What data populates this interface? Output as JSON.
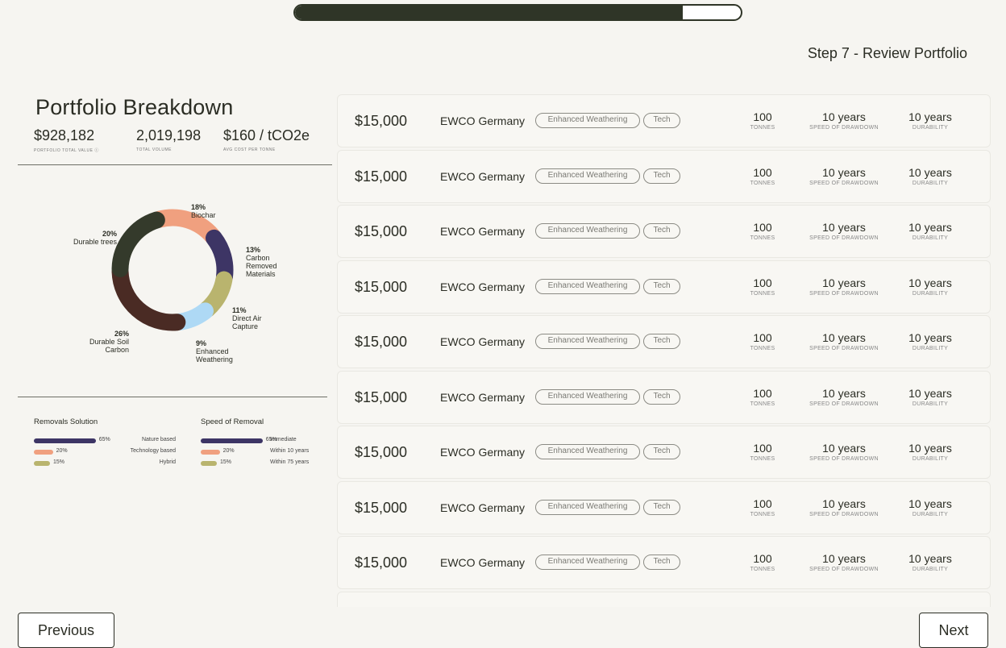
{
  "progress": {
    "value": 0.87
  },
  "step_title": "Step 7 - Review Portfolio",
  "breakdown": {
    "title": "Portfolio Breakdown",
    "stats": [
      {
        "value": "$928,182",
        "label": "PORTFOLIO TOTAL VALUE ⓘ"
      },
      {
        "value": "2,019,198",
        "label": "TOTAL VOLUME"
      },
      {
        "value": "$160 / tCO2e",
        "label": "AVG COST PER TONNE"
      }
    ]
  },
  "donut": {
    "segments": [
      {
        "name": "Biochar",
        "pct_label": "18%",
        "value": 18,
        "color": "#f0a07f"
      },
      {
        "name": "Carbon Removed Materials",
        "pct_label": "13%",
        "value": 13,
        "color": "#3d3565"
      },
      {
        "name": "Direct Air Capture",
        "pct_label": "11%",
        "value": 11,
        "color": "#b9b46e"
      },
      {
        "name": "Enhanced Weathering",
        "pct_label": "9%",
        "value": 9,
        "color": "#aed9f5"
      },
      {
        "name": "Durable Soil Carbon",
        "pct_label": "26%",
        "value": 26,
        "color": "#4a2b24"
      },
      {
        "name": "Durable trees",
        "pct_label": "20%",
        "value": 20,
        "color": "#343a2b"
      }
    ],
    "labels": {
      "biochar": {
        "pct": "18%",
        "text": "Biochar"
      },
      "crm": {
        "pct": "13%",
        "line1": "Carbon",
        "line2": "Removed",
        "line3": "Materials"
      },
      "dac": {
        "pct": "11%",
        "line1": "Direct Air",
        "line2": "Capture"
      },
      "ew": {
        "pct": "9%",
        "line1": "Enhanced",
        "line2": "Weathering"
      },
      "dsc": {
        "pct": "26%",
        "line1": "Durable Soil",
        "line2": "Carbon"
      },
      "trees": {
        "pct": "20%",
        "text": "Durable trees"
      }
    }
  },
  "removals_solution": {
    "title": "Removals Solution",
    "items": [
      {
        "pct": "65%",
        "value": 65,
        "name": "Nature based",
        "color": "#3d3565"
      },
      {
        "pct": "20%",
        "value": 20,
        "name": "Technology based",
        "color": "#f0a07f"
      },
      {
        "pct": "15%",
        "value": 15,
        "name": "Hybrid",
        "color": "#b9b46e"
      }
    ]
  },
  "speed_of_removal": {
    "title": "Speed of Removal",
    "items": [
      {
        "pct": "65%",
        "value": 65,
        "name": "Immediate",
        "color": "#3d3565"
      },
      {
        "pct": "20%",
        "value": 20,
        "name": "Within 10 years",
        "color": "#f0a07f"
      },
      {
        "pct": "15%",
        "value": 15,
        "name": "Within 75 years",
        "color": "#b9b46e"
      }
    ]
  },
  "projects": [
    {
      "price": "$15,000",
      "name": "EWCO Germany",
      "tag1": "Enhanced Weathering",
      "tag2": "Tech",
      "tonnes": "100",
      "tonnes_label": "TONNES",
      "speed": "10 years",
      "speed_label": "SPEED OF DRAWDOWN",
      "durability": "10 years",
      "durability_label": "DURABILITY"
    },
    {
      "price": "$15,000",
      "name": "EWCO Germany",
      "tag1": "Enhanced Weathering",
      "tag2": "Tech",
      "tonnes": "100",
      "tonnes_label": "TONNES",
      "speed": "10 years",
      "speed_label": "SPEED OF DRAWDOWN",
      "durability": "10 years",
      "durability_label": "DURABILITY"
    },
    {
      "price": "$15,000",
      "name": "EWCO Germany",
      "tag1": "Enhanced Weathering",
      "tag2": "Tech",
      "tonnes": "100",
      "tonnes_label": "TONNES",
      "speed": "10 years",
      "speed_label": "SPEED OF DRAWDOWN",
      "durability": "10 years",
      "durability_label": "DURABILITY"
    },
    {
      "price": "$15,000",
      "name": "EWCO Germany",
      "tag1": "Enhanced Weathering",
      "tag2": "Tech",
      "tonnes": "100",
      "tonnes_label": "TONNES",
      "speed": "10 years",
      "speed_label": "SPEED OF DRAWDOWN",
      "durability": "10 years",
      "durability_label": "DURABILITY"
    },
    {
      "price": "$15,000",
      "name": "EWCO Germany",
      "tag1": "Enhanced Weathering",
      "tag2": "Tech",
      "tonnes": "100",
      "tonnes_label": "TONNES",
      "speed": "10 years",
      "speed_label": "SPEED OF DRAWDOWN",
      "durability": "10 years",
      "durability_label": "DURABILITY"
    },
    {
      "price": "$15,000",
      "name": "EWCO Germany",
      "tag1": "Enhanced Weathering",
      "tag2": "Tech",
      "tonnes": "100",
      "tonnes_label": "TONNES",
      "speed": "10 years",
      "speed_label": "SPEED OF DRAWDOWN",
      "durability": "10 years",
      "durability_label": "DURABILITY"
    },
    {
      "price": "$15,000",
      "name": "EWCO Germany",
      "tag1": "Enhanced Weathering",
      "tag2": "Tech",
      "tonnes": "100",
      "tonnes_label": "TONNES",
      "speed": "10 years",
      "speed_label": "SPEED OF DRAWDOWN",
      "durability": "10 years",
      "durability_label": "DURABILITY"
    },
    {
      "price": "$15,000",
      "name": "EWCO Germany",
      "tag1": "Enhanced Weathering",
      "tag2": "Tech",
      "tonnes": "100",
      "tonnes_label": "TONNES",
      "speed": "10 years",
      "speed_label": "SPEED OF DRAWDOWN",
      "durability": "10 years",
      "durability_label": "DURABILITY"
    },
    {
      "price": "$15,000",
      "name": "EWCO Germany",
      "tag1": "Enhanced Weathering",
      "tag2": "Tech",
      "tonnes": "100",
      "tonnes_label": "TONNES",
      "speed": "10 years",
      "speed_label": "SPEED OF DRAWDOWN",
      "durability": "10 years",
      "durability_label": "DURABILITY"
    }
  ],
  "nav": {
    "previous": "Previous",
    "next": "Next"
  }
}
